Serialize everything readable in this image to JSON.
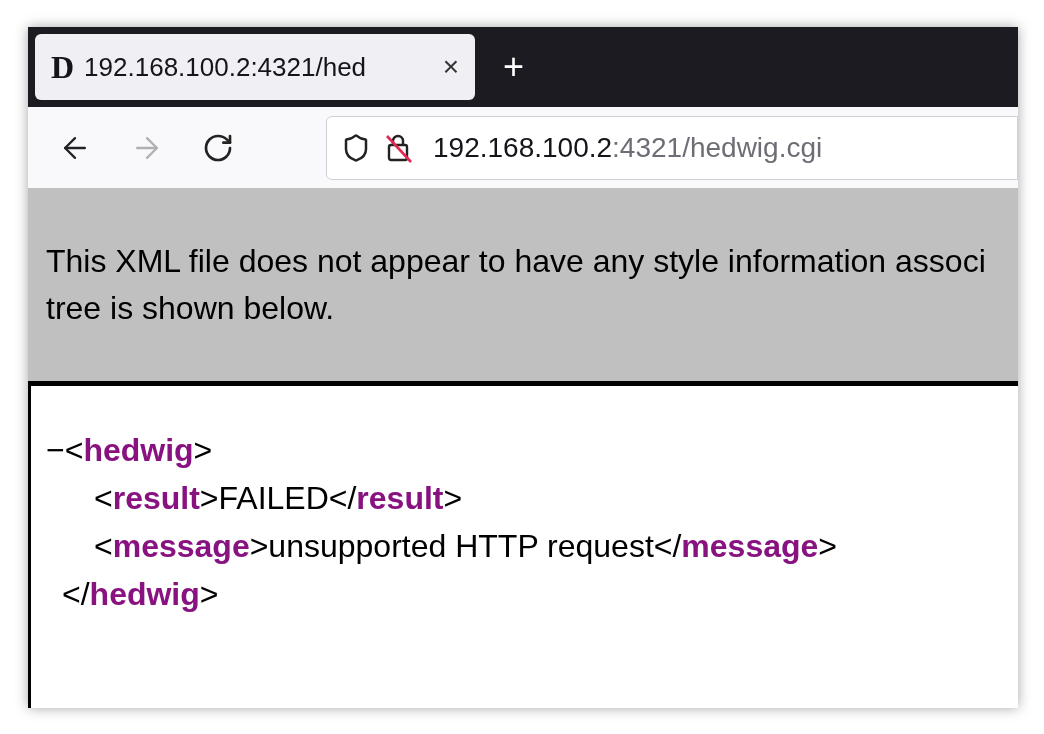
{
  "tabs": [
    {
      "favicon": "D",
      "title": "192.168.100.2:4321/hed",
      "close": "×",
      "selected": true
    }
  ],
  "new_tab": "+",
  "nav": {
    "back_disabled": false,
    "forward_disabled": true
  },
  "address": {
    "host": "192.168.100.2",
    "rest": ":4321/hedwig.cgi",
    "secure": false
  },
  "banner": {
    "lines": [
      "This XML file does not appear to have any style information associ",
      "tree is shown below."
    ]
  },
  "xml": {
    "toggle": "−",
    "open": [
      {
        "kind": "punct",
        "text": "<"
      },
      {
        "kind": "tag",
        "text": "hedwig"
      },
      {
        "kind": "punct",
        "text": ">"
      }
    ],
    "children": [
      {
        "tokens": [
          {
            "kind": "punct",
            "text": "<"
          },
          {
            "kind": "tag",
            "text": "result"
          },
          {
            "kind": "punct",
            "text": ">"
          },
          {
            "kind": "text",
            "text": "FAILED"
          },
          {
            "kind": "punct",
            "text": "</"
          },
          {
            "kind": "tag",
            "text": "result"
          },
          {
            "kind": "punct",
            "text": ">"
          }
        ]
      },
      {
        "tokens": [
          {
            "kind": "punct",
            "text": "<"
          },
          {
            "kind": "tag",
            "text": "message"
          },
          {
            "kind": "punct",
            "text": ">"
          },
          {
            "kind": "text",
            "text": "unsupported HTTP request"
          },
          {
            "kind": "punct",
            "text": "</"
          },
          {
            "kind": "tag",
            "text": "message"
          },
          {
            "kind": "punct",
            "text": ">"
          }
        ]
      }
    ],
    "close": [
      {
        "kind": "punct",
        "text": "</"
      },
      {
        "kind": "tag",
        "text": "hedwig"
      },
      {
        "kind": "punct",
        "text": ">"
      }
    ]
  }
}
